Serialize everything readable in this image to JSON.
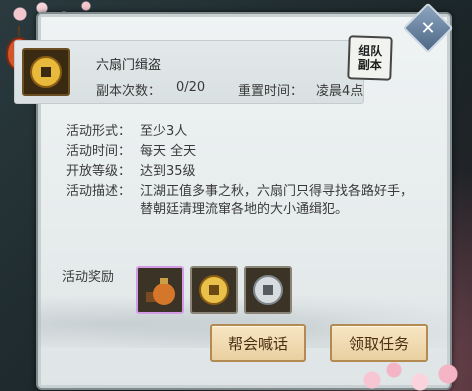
{
  "dungeon": {
    "title": "六扇门缉盗",
    "run_count_label": "副本次数：",
    "run_count_value": "0/20",
    "reset_label": "重置时间：",
    "reset_value": "凌晨4点"
  },
  "badge": {
    "line1": "组队",
    "line2": "副本"
  },
  "details": {
    "form_label": "活动形式：",
    "form_value": "至少3人",
    "time_label": "活动时间：",
    "time_value": "每天 全天",
    "level_label": "开放等级：",
    "level_value": "达到35级",
    "desc_label": "活动描述：",
    "desc_line1": "江湖正值多事之秋，六扇门只得寻找各路好手，",
    "desc_line2": "替朝廷清理流窜各地的大小通缉犯。"
  },
  "rewards": {
    "label": "活动奖励",
    "items": [
      {
        "icon": "money-bag-icon",
        "selected": true
      },
      {
        "icon": "gold-coin-icon",
        "selected": false
      },
      {
        "icon": "silver-coin-icon",
        "selected": false
      }
    ]
  },
  "buttons": {
    "guild_shout": "帮会喊话",
    "accept_task": "领取任务"
  },
  "colors": {
    "panel_bg": "#e7eced",
    "button_bg": "#ead0a1",
    "button_text": "#4a2e12",
    "selected_border": "#d39be6"
  }
}
